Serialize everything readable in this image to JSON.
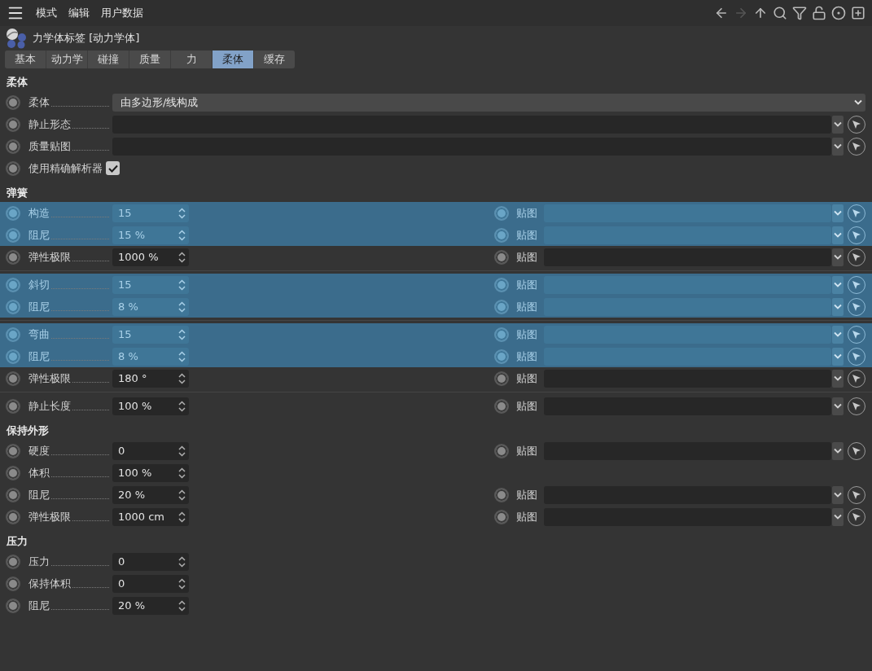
{
  "menu": [
    "模式",
    "编辑",
    "用户数据"
  ],
  "toolbar": [
    {
      "kind": "back",
      "disabled": false
    },
    {
      "kind": "forward",
      "disabled": true
    },
    {
      "kind": "up",
      "disabled": false
    },
    {
      "kind": "search",
      "disabled": false
    },
    {
      "kind": "filter",
      "disabled": false
    },
    {
      "kind": "lock",
      "disabled": false
    },
    {
      "kind": "target",
      "disabled": false
    },
    {
      "kind": "new",
      "disabled": false
    }
  ],
  "title": "力学体标签 [动力学体]",
  "tabs": [
    {
      "label": "基本",
      "selected": false
    },
    {
      "label": "动力学",
      "selected": false
    },
    {
      "label": "碰撞",
      "selected": false
    },
    {
      "label": "质量",
      "selected": false
    },
    {
      "label": "力",
      "selected": false
    },
    {
      "label": "柔体",
      "selected": true
    },
    {
      "label": "缓存",
      "selected": false
    }
  ],
  "sections": [
    {
      "title": "柔体",
      "groups": [
        {
          "rows": [
            {
              "kind": "dropdown",
              "label": "柔体",
              "value": "由多边形/线构成",
              "selected": false
            },
            {
              "kind": "link",
              "label": "静止形态",
              "selected": false
            },
            {
              "kind": "link",
              "label": "质量贴图",
              "selected": false
            },
            {
              "kind": "checkbox",
              "label": "使用精确解析器",
              "checked": true,
              "selected": false
            }
          ]
        }
      ]
    },
    {
      "title": "弹簧",
      "groups": [
        {
          "rows": [
            {
              "kind": "number",
              "label": "构造",
              "value": "15",
              "selected": true,
              "map": "贴图"
            },
            {
              "kind": "number",
              "label": "阻尼",
              "value": "15 %",
              "selected": true,
              "map": "贴图"
            },
            {
              "kind": "number",
              "label": "弹性极限",
              "value": "1000 %",
              "selected": false,
              "map": "贴图"
            }
          ]
        },
        {
          "rows": [
            {
              "kind": "number",
              "label": "斜切",
              "value": "15",
              "selected": true,
              "map": "贴图"
            },
            {
              "kind": "number",
              "label": "阻尼",
              "value": "8 %",
              "selected": true,
              "map": "贴图"
            }
          ]
        },
        {
          "rows": [
            {
              "kind": "number",
              "label": "弯曲",
              "value": "15",
              "selected": true,
              "map": "贴图"
            },
            {
              "kind": "number",
              "label": "阻尼",
              "value": "8 %",
              "selected": true,
              "map": "贴图"
            },
            {
              "kind": "number",
              "label": "弹性极限",
              "value": "180 °",
              "selected": false,
              "map": "贴图"
            }
          ]
        },
        {
          "rows": [
            {
              "kind": "number",
              "label": "静止长度",
              "value": "100 %",
              "selected": false,
              "map": "贴图"
            }
          ]
        }
      ]
    },
    {
      "title": "保持外形",
      "groups": [
        {
          "rows": [
            {
              "kind": "number",
              "label": "硬度",
              "value": "0",
              "selected": false,
              "map": "贴图"
            },
            {
              "kind": "number",
              "label": "体积",
              "value": "100 %",
              "selected": false
            },
            {
              "kind": "number",
              "label": "阻尼",
              "value": "20 %",
              "selected": false,
              "map": "贴图"
            },
            {
              "kind": "number",
              "label": "弹性极限",
              "value": "1000 cm",
              "selected": false,
              "map": "贴图"
            }
          ]
        }
      ]
    },
    {
      "title": "压力",
      "groups": [
        {
          "rows": [
            {
              "kind": "number",
              "label": "压力",
              "value": "0",
              "selected": false
            },
            {
              "kind": "number",
              "label": "保持体积",
              "value": "0",
              "selected": false
            },
            {
              "kind": "number",
              "label": "阻尼",
              "value": "20 %",
              "selected": false
            }
          ]
        }
      ]
    }
  ]
}
